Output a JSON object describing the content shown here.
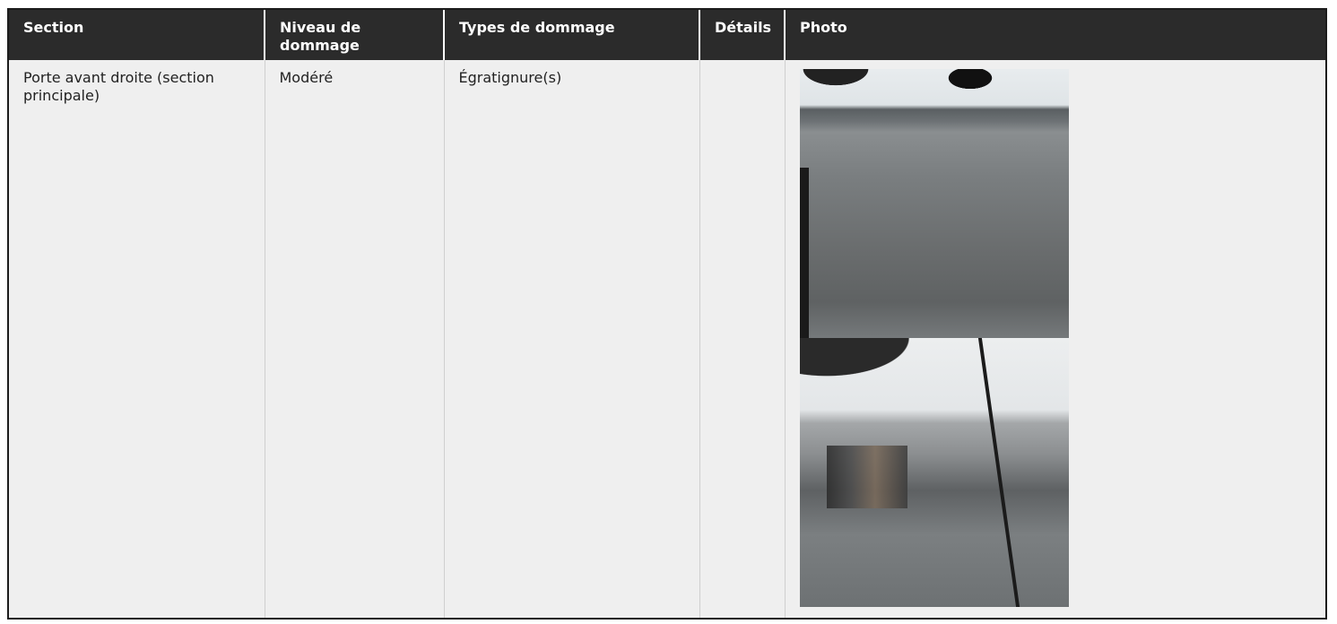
{
  "table": {
    "headers": [
      "Section",
      "Niveau de dommage",
      "Types de dommage",
      "Détails",
      "Photo"
    ],
    "rows": [
      {
        "section": "Porte avant droite (section principale)",
        "niveau": "Modéré",
        "types": "Égratignure(s)",
        "details": "",
        "photos": [
          "damage-photo-1",
          "damage-photo-2"
        ]
      }
    ]
  }
}
